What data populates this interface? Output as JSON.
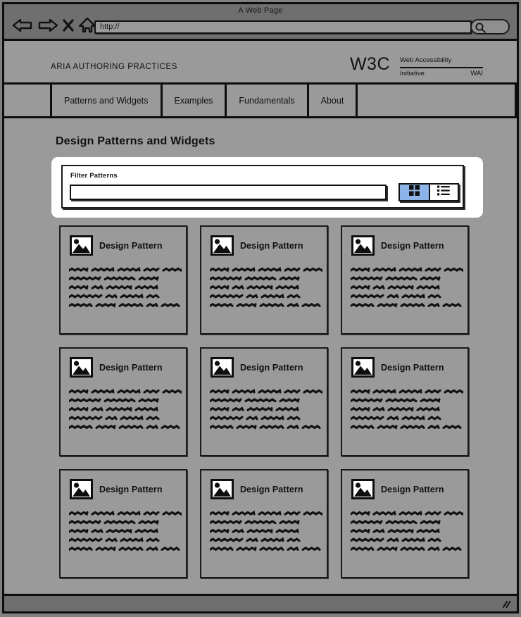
{
  "browser": {
    "window_title": "A Web Page",
    "url_value": "http://",
    "nav_icons": [
      "back-arrow-icon",
      "forward-arrow-icon",
      "stop-x-icon",
      "home-icon"
    ],
    "search_icon": "magnifier-icon"
  },
  "site": {
    "title": "ARIA AUTHORING PRACTICES",
    "logo": {
      "mark": "W3C",
      "line1": "Web Accessibility",
      "line2_left": "Initiative",
      "line2_right": "WAI"
    },
    "nav": [
      {
        "label": "Patterns and Widgets"
      },
      {
        "label": "Examples"
      },
      {
        "label": "Fundamentals"
      },
      {
        "label": "About"
      }
    ]
  },
  "page": {
    "heading": "Design Patterns and Widgets",
    "filter": {
      "label": "Filter Patterns",
      "input_value": "",
      "input_placeholder": "",
      "view_buttons": [
        {
          "name": "grid-view-button",
          "icon": "grid-icon",
          "selected": true
        },
        {
          "name": "list-view-button",
          "icon": "list-icon",
          "selected": false
        }
      ],
      "selected_color": "#8cb4e8"
    },
    "cards": [
      {
        "title": "Design Pattern",
        "icon": "image-placeholder-icon"
      },
      {
        "title": "Design Pattern",
        "icon": "image-placeholder-icon"
      },
      {
        "title": "Design Pattern",
        "icon": "image-placeholder-icon"
      },
      {
        "title": "Design Pattern",
        "icon": "image-placeholder-icon"
      },
      {
        "title": "Design Pattern",
        "icon": "image-placeholder-icon"
      },
      {
        "title": "Design Pattern",
        "icon": "image-placeholder-icon"
      },
      {
        "title": "Design Pattern",
        "icon": "image-placeholder-icon"
      },
      {
        "title": "Design Pattern",
        "icon": "image-placeholder-icon"
      },
      {
        "title": "Design Pattern",
        "icon": "image-placeholder-icon"
      }
    ],
    "card_body_placeholder_lines": 5
  },
  "statusbar": {
    "resize_grip_icon": "resize-grip-icon"
  }
}
